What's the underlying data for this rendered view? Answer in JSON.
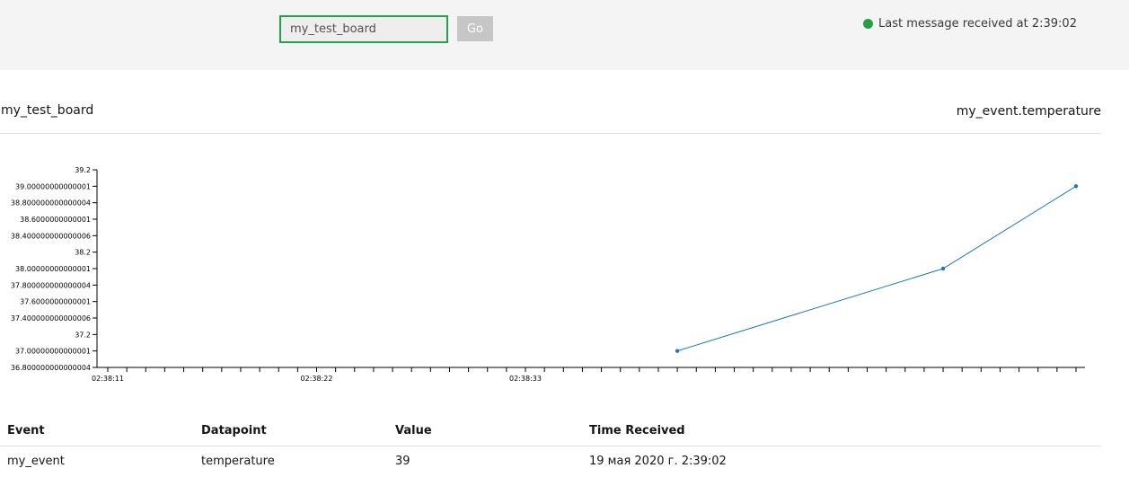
{
  "toolbar": {
    "board_input_value": "my_test_board",
    "go_label": "Go",
    "status_text": "Last message received at 2:39:02",
    "status_color": "#24a148"
  },
  "panel": {
    "board_title": "my_test_board",
    "metric_title": "my_event.temperature"
  },
  "chart_data": {
    "type": "line",
    "series": [
      {
        "points": [
          {
            "x": "02:38:41",
            "y": 37.0
          },
          {
            "x": "02:38:55",
            "y": 38.0
          },
          {
            "x": "02:39:02",
            "y": 39.0
          }
        ],
        "color": "#1f77b4"
      }
    ],
    "y_ticks": [
      "36.800000000000004",
      "37.00000000000001",
      "37.2",
      "37.400000000000006",
      "37.6000000000001",
      "37.800000000000004",
      "38.00000000000001",
      "38.2",
      "38.400000000000006",
      "38.6000000000001",
      "38.800000000000004",
      "39.00000000000001",
      "39.2"
    ],
    "x_tick_labels": [
      "02:38:11",
      "02:38:22",
      "02:38:33"
    ],
    "ylim": [
      36.8,
      39.2
    ],
    "xlim": [
      "02:38:11",
      "02:39:02"
    ],
    "grid": false
  },
  "table": {
    "columns": [
      "Event",
      "Datapoint",
      "Value",
      "Time Received"
    ],
    "rows": [
      [
        "my_event",
        "temperature",
        "39",
        "19 мая 2020 г. 2:39:02"
      ]
    ]
  }
}
